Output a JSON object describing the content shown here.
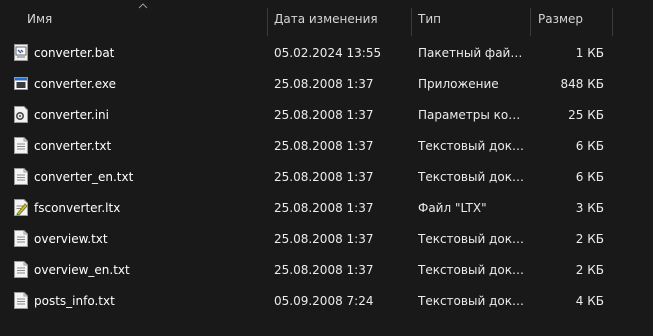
{
  "columns": {
    "name": "Имя",
    "date": "Дата изменения",
    "type": "Тип",
    "size": "Размер"
  },
  "files": [
    {
      "name": "converter.bat",
      "date": "05.02.2024 13:55",
      "type": "Пакетный файл ...",
      "size": "1 КБ",
      "icon": "batch-file-icon"
    },
    {
      "name": "converter.exe",
      "date": "25.08.2008 1:37",
      "type": "Приложение",
      "size": "848 КБ",
      "icon": "application-icon"
    },
    {
      "name": "converter.ini",
      "date": "25.08.2008 1:37",
      "type": "Параметры конф...",
      "size": "25 КБ",
      "icon": "settings-file-icon"
    },
    {
      "name": "converter.txt",
      "date": "25.08.2008 1:37",
      "type": "Текстовый докум...",
      "size": "6 КБ",
      "icon": "text-file-icon"
    },
    {
      "name": "converter_en.txt",
      "date": "25.08.2008 1:37",
      "type": "Текстовый докум...",
      "size": "6 КБ",
      "icon": "text-file-icon"
    },
    {
      "name": "fsconverter.ltx",
      "date": "25.08.2008 1:37",
      "type": "Файл \"LTX\"",
      "size": "3 КБ",
      "icon": "ltx-file-icon"
    },
    {
      "name": "overview.txt",
      "date": "25.08.2008 1:37",
      "type": "Текстовый докум...",
      "size": "2 КБ",
      "icon": "text-file-icon"
    },
    {
      "name": "overview_en.txt",
      "date": "25.08.2008 1:37",
      "type": "Текстовый докум...",
      "size": "2 КБ",
      "icon": "text-file-icon"
    },
    {
      "name": "posts_info.txt",
      "date": "05.09.2008 7:24",
      "type": "Текстовый докум...",
      "size": "4 КБ",
      "icon": "text-file-icon"
    }
  ]
}
